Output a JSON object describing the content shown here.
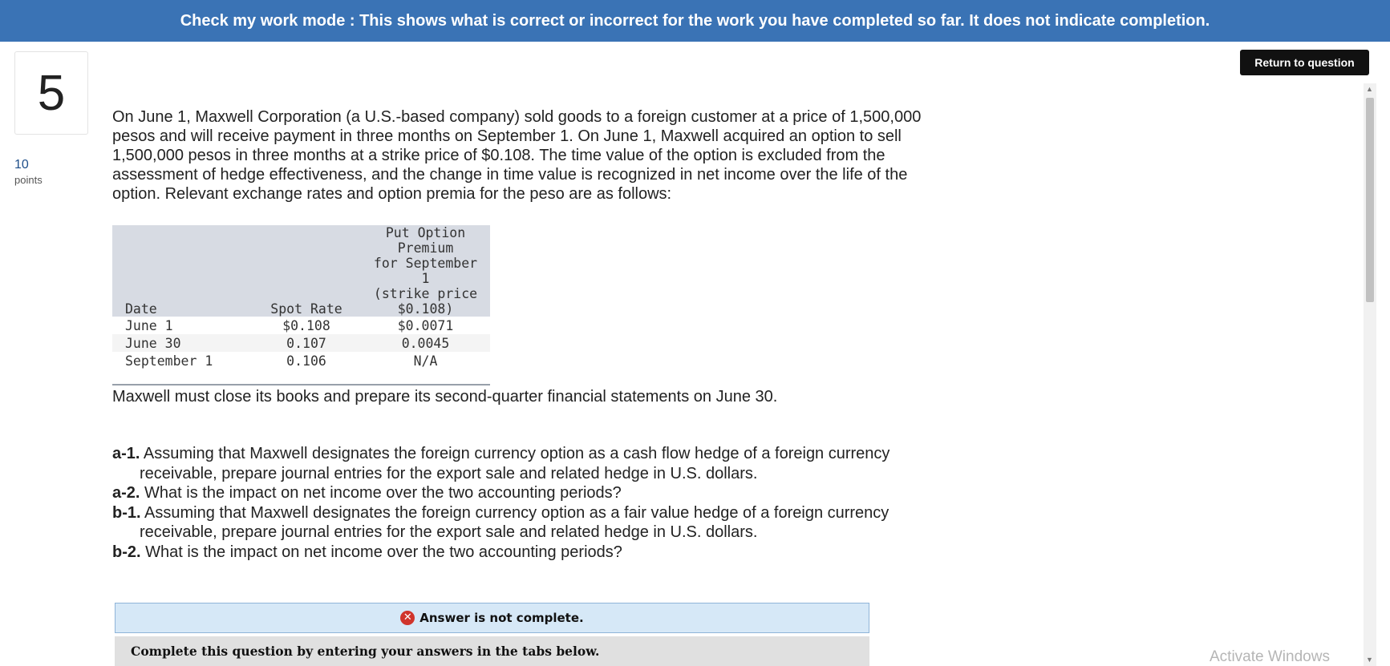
{
  "banner": {
    "text": "Check my work mode : This shows what is correct or incorrect for the work you have completed so far. It does not indicate completion."
  },
  "return_button": {
    "label": "Return to question"
  },
  "question": {
    "number": "5",
    "points_value": "10",
    "points_label": "points",
    "intro": "On June 1, Maxwell Corporation (a U.S.-based company) sold goods to a foreign customer at a price of 1,500,000 pesos and will receive payment in three months on September 1. On June 1, Maxwell acquired an option to sell 1,500,000 pesos in three months at a strike price of $0.108. The time value of the option is excluded from the assessment of hedge effectiveness, and the change in time value is recognized in net income over the life of the option. Relevant exchange rates and option premia for the peso are as follows:",
    "close_note": "Maxwell must close its books and prepare its second-quarter financial statements on June 30.",
    "table": {
      "headers": {
        "date": "Date",
        "spot": "Spot Rate",
        "put_lines": [
          "Put Option Premium",
          "for September 1",
          "(strike price",
          "$0.108)"
        ]
      },
      "rows": [
        {
          "date": "June 1",
          "spot": "$0.108",
          "put": "$0.0071"
        },
        {
          "date": "June 30",
          "spot": "0.107",
          "put": "0.0045"
        },
        {
          "date": "September 1",
          "spot": "0.106",
          "put": "N/A"
        }
      ]
    },
    "requirements": [
      {
        "label": "a-1.",
        "text": "Assuming that Maxwell designates the foreign currency option as a cash flow hedge of a foreign currency receivable, prepare journal entries for the export sale and related hedge in U.S. dollars."
      },
      {
        "label": "a-2.",
        "text": "What is the impact on net income over the two accounting periods?"
      },
      {
        "label": "b-1.",
        "text": "Assuming that Maxwell designates the foreign currency option as a fair value hedge of a foreign currency receivable, prepare journal entries for the export sale and related hedge in U.S. dollars."
      },
      {
        "label": "b-2.",
        "text": "What is the impact on net income over the two accounting periods?"
      }
    ]
  },
  "answer_status": {
    "icon": "x-circle-icon",
    "text": "Answer is not complete.",
    "color": "#d0342c"
  },
  "instructions": {
    "text": "Complete this question by entering your answers in the tabs below."
  },
  "watermark": {
    "text": "Activate Windows"
  },
  "colors": {
    "banner": "#3a73b5",
    "answer_box": "#d6e8f7",
    "table_header": "#d7dbe3"
  }
}
